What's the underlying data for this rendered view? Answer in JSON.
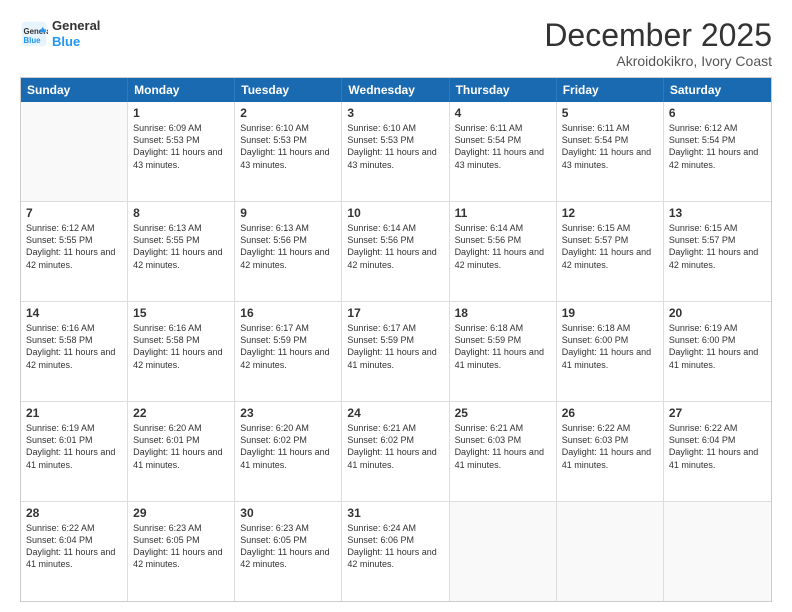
{
  "logo": {
    "line1": "General",
    "line2": "Blue"
  },
  "title": "December 2025",
  "subtitle": "Akroidokikro, Ivory Coast",
  "header_days": [
    "Sunday",
    "Monday",
    "Tuesday",
    "Wednesday",
    "Thursday",
    "Friday",
    "Saturday"
  ],
  "weeks": [
    [
      {
        "day": "",
        "sunrise": "",
        "sunset": "",
        "daylight": ""
      },
      {
        "day": "1",
        "sunrise": "Sunrise: 6:09 AM",
        "sunset": "Sunset: 5:53 PM",
        "daylight": "Daylight: 11 hours and 43 minutes."
      },
      {
        "day": "2",
        "sunrise": "Sunrise: 6:10 AM",
        "sunset": "Sunset: 5:53 PM",
        "daylight": "Daylight: 11 hours and 43 minutes."
      },
      {
        "day": "3",
        "sunrise": "Sunrise: 6:10 AM",
        "sunset": "Sunset: 5:53 PM",
        "daylight": "Daylight: 11 hours and 43 minutes."
      },
      {
        "day": "4",
        "sunrise": "Sunrise: 6:11 AM",
        "sunset": "Sunset: 5:54 PM",
        "daylight": "Daylight: 11 hours and 43 minutes."
      },
      {
        "day": "5",
        "sunrise": "Sunrise: 6:11 AM",
        "sunset": "Sunset: 5:54 PM",
        "daylight": "Daylight: 11 hours and 43 minutes."
      },
      {
        "day": "6",
        "sunrise": "Sunrise: 6:12 AM",
        "sunset": "Sunset: 5:54 PM",
        "daylight": "Daylight: 11 hours and 42 minutes."
      }
    ],
    [
      {
        "day": "7",
        "sunrise": "Sunrise: 6:12 AM",
        "sunset": "Sunset: 5:55 PM",
        "daylight": "Daylight: 11 hours and 42 minutes."
      },
      {
        "day": "8",
        "sunrise": "Sunrise: 6:13 AM",
        "sunset": "Sunset: 5:55 PM",
        "daylight": "Daylight: 11 hours and 42 minutes."
      },
      {
        "day": "9",
        "sunrise": "Sunrise: 6:13 AM",
        "sunset": "Sunset: 5:56 PM",
        "daylight": "Daylight: 11 hours and 42 minutes."
      },
      {
        "day": "10",
        "sunrise": "Sunrise: 6:14 AM",
        "sunset": "Sunset: 5:56 PM",
        "daylight": "Daylight: 11 hours and 42 minutes."
      },
      {
        "day": "11",
        "sunrise": "Sunrise: 6:14 AM",
        "sunset": "Sunset: 5:56 PM",
        "daylight": "Daylight: 11 hours and 42 minutes."
      },
      {
        "day": "12",
        "sunrise": "Sunrise: 6:15 AM",
        "sunset": "Sunset: 5:57 PM",
        "daylight": "Daylight: 11 hours and 42 minutes."
      },
      {
        "day": "13",
        "sunrise": "Sunrise: 6:15 AM",
        "sunset": "Sunset: 5:57 PM",
        "daylight": "Daylight: 11 hours and 42 minutes."
      }
    ],
    [
      {
        "day": "14",
        "sunrise": "Sunrise: 6:16 AM",
        "sunset": "Sunset: 5:58 PM",
        "daylight": "Daylight: 11 hours and 42 minutes."
      },
      {
        "day": "15",
        "sunrise": "Sunrise: 6:16 AM",
        "sunset": "Sunset: 5:58 PM",
        "daylight": "Daylight: 11 hours and 42 minutes."
      },
      {
        "day": "16",
        "sunrise": "Sunrise: 6:17 AM",
        "sunset": "Sunset: 5:59 PM",
        "daylight": "Daylight: 11 hours and 42 minutes."
      },
      {
        "day": "17",
        "sunrise": "Sunrise: 6:17 AM",
        "sunset": "Sunset: 5:59 PM",
        "daylight": "Daylight: 11 hours and 41 minutes."
      },
      {
        "day": "18",
        "sunrise": "Sunrise: 6:18 AM",
        "sunset": "Sunset: 5:59 PM",
        "daylight": "Daylight: 11 hours and 41 minutes."
      },
      {
        "day": "19",
        "sunrise": "Sunrise: 6:18 AM",
        "sunset": "Sunset: 6:00 PM",
        "daylight": "Daylight: 11 hours and 41 minutes."
      },
      {
        "day": "20",
        "sunrise": "Sunrise: 6:19 AM",
        "sunset": "Sunset: 6:00 PM",
        "daylight": "Daylight: 11 hours and 41 minutes."
      }
    ],
    [
      {
        "day": "21",
        "sunrise": "Sunrise: 6:19 AM",
        "sunset": "Sunset: 6:01 PM",
        "daylight": "Daylight: 11 hours and 41 minutes."
      },
      {
        "day": "22",
        "sunrise": "Sunrise: 6:20 AM",
        "sunset": "Sunset: 6:01 PM",
        "daylight": "Daylight: 11 hours and 41 minutes."
      },
      {
        "day": "23",
        "sunrise": "Sunrise: 6:20 AM",
        "sunset": "Sunset: 6:02 PM",
        "daylight": "Daylight: 11 hours and 41 minutes."
      },
      {
        "day": "24",
        "sunrise": "Sunrise: 6:21 AM",
        "sunset": "Sunset: 6:02 PM",
        "daylight": "Daylight: 11 hours and 41 minutes."
      },
      {
        "day": "25",
        "sunrise": "Sunrise: 6:21 AM",
        "sunset": "Sunset: 6:03 PM",
        "daylight": "Daylight: 11 hours and 41 minutes."
      },
      {
        "day": "26",
        "sunrise": "Sunrise: 6:22 AM",
        "sunset": "Sunset: 6:03 PM",
        "daylight": "Daylight: 11 hours and 41 minutes."
      },
      {
        "day": "27",
        "sunrise": "Sunrise: 6:22 AM",
        "sunset": "Sunset: 6:04 PM",
        "daylight": "Daylight: 11 hours and 41 minutes."
      }
    ],
    [
      {
        "day": "28",
        "sunrise": "Sunrise: 6:22 AM",
        "sunset": "Sunset: 6:04 PM",
        "daylight": "Daylight: 11 hours and 41 minutes."
      },
      {
        "day": "29",
        "sunrise": "Sunrise: 6:23 AM",
        "sunset": "Sunset: 6:05 PM",
        "daylight": "Daylight: 11 hours and 42 minutes."
      },
      {
        "day": "30",
        "sunrise": "Sunrise: 6:23 AM",
        "sunset": "Sunset: 6:05 PM",
        "daylight": "Daylight: 11 hours and 42 minutes."
      },
      {
        "day": "31",
        "sunrise": "Sunrise: 6:24 AM",
        "sunset": "Sunset: 6:06 PM",
        "daylight": "Daylight: 11 hours and 42 minutes."
      },
      {
        "day": "",
        "sunrise": "",
        "sunset": "",
        "daylight": ""
      },
      {
        "day": "",
        "sunrise": "",
        "sunset": "",
        "daylight": ""
      },
      {
        "day": "",
        "sunrise": "",
        "sunset": "",
        "daylight": ""
      }
    ]
  ]
}
